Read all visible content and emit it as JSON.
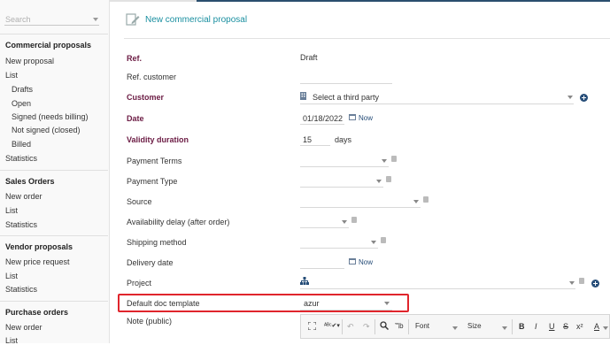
{
  "sidebar": {
    "search_placeholder": "Search",
    "sections": [
      {
        "title": "Commercial proposals",
        "items": [
          "New proposal",
          "List"
        ],
        "subitems": [
          "Drafts",
          "Open",
          "Signed (needs billing)",
          "Not signed (closed)",
          "Billed"
        ],
        "after": [
          "Statistics"
        ]
      },
      {
        "title": "Sales Orders",
        "items": [
          "New order",
          "List",
          "Statistics"
        ]
      },
      {
        "title": "Vendor proposals",
        "items": [
          "New price request",
          "List",
          "Statistics"
        ]
      },
      {
        "title": "Purchase orders",
        "items": [
          "New order",
          "List"
        ]
      }
    ]
  },
  "header": {
    "title": "New commercial proposal"
  },
  "form": {
    "ref_label": "Ref.",
    "ref_value": "Draft",
    "ref_customer_label": "Ref. customer",
    "customer_label": "Customer",
    "customer_value": "Select a third party",
    "date_label": "Date",
    "date_value": "01/18/2022",
    "now_label": "Now",
    "validity_label": "Validity duration",
    "validity_value": "15",
    "validity_unit": "days",
    "payment_terms_label": "Payment Terms",
    "payment_type_label": "Payment Type",
    "source_label": "Source",
    "availability_label": "Availability delay (after order)",
    "shipping_label": "Shipping method",
    "delivery_label": "Delivery date",
    "delivery_now": "Now",
    "project_label": "Project",
    "template_label": "Default doc template",
    "template_value": "azur",
    "note_label": "Note (public)"
  },
  "editor": {
    "font_label": "Font",
    "size_label": "Size",
    "bold": "B",
    "italic": "I",
    "underline": "U",
    "strike": "S",
    "superscript": "x²",
    "textcolor": "A"
  },
  "colors": {
    "required_label": "#6b1b43",
    "accent": "#1a8fa0",
    "highlight": "#e0252c"
  }
}
